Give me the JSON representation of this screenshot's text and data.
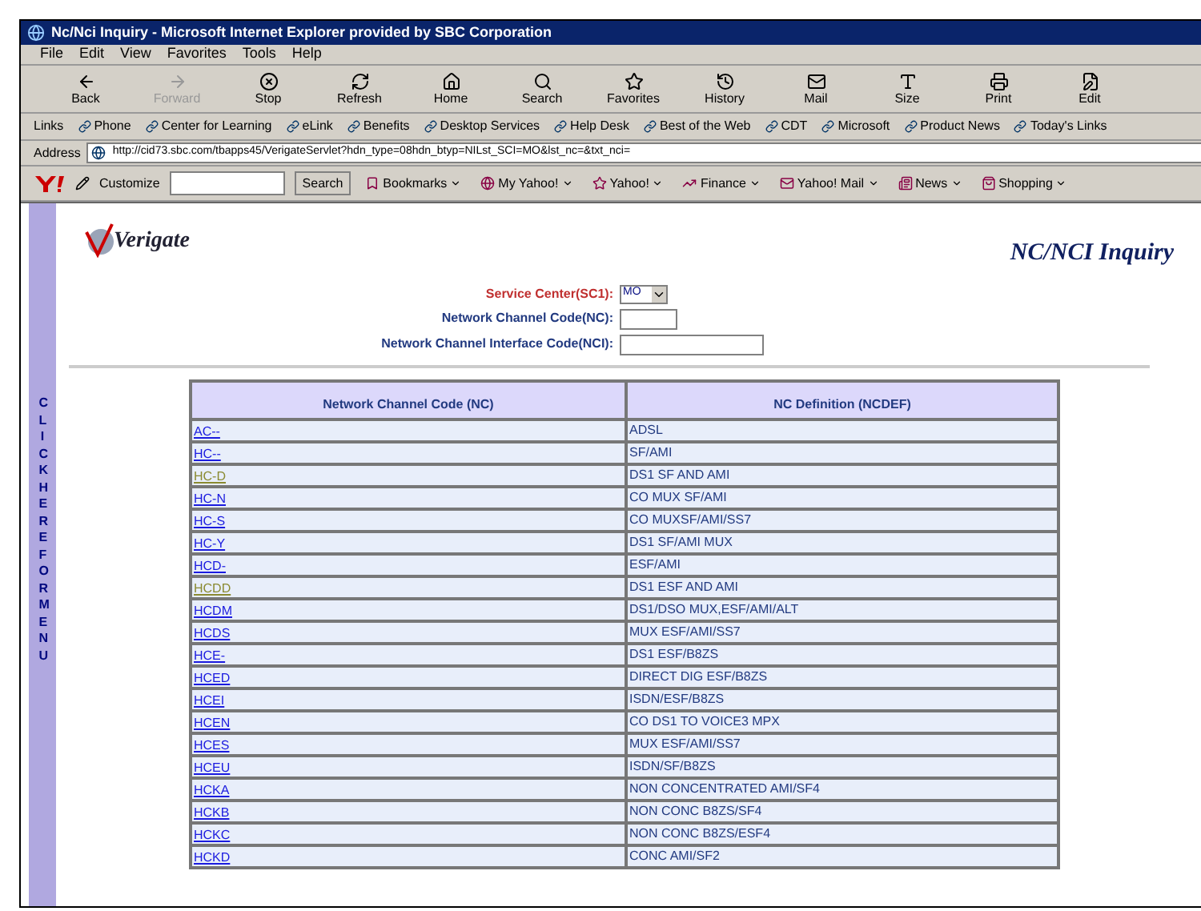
{
  "window": {
    "title": "Nc/Nci Inquiry - Microsoft Internet Explorer provided by SBC Corporation"
  },
  "menu": [
    "File",
    "Edit",
    "View",
    "Favorites",
    "Tools",
    "Help"
  ],
  "toolbar": [
    {
      "label": "Back",
      "disabled": false
    },
    {
      "label": "Forward",
      "disabled": true
    },
    {
      "label": "Stop",
      "disabled": false
    },
    {
      "label": "Refresh",
      "disabled": false
    },
    {
      "label": "Home",
      "disabled": false
    },
    {
      "label": "Search",
      "disabled": false
    },
    {
      "label": "Favorites",
      "disabled": false
    },
    {
      "label": "History",
      "disabled": false
    },
    {
      "label": "Mail",
      "disabled": false
    },
    {
      "label": "Size",
      "disabled": false
    },
    {
      "label": "Print",
      "disabled": false
    },
    {
      "label": "Edit",
      "disabled": false
    }
  ],
  "links_bar": {
    "label": "Links",
    "items": [
      "Phone",
      "Center for Learning",
      "eLink",
      "Benefits",
      "Desktop Services",
      "Help Desk",
      "Best of the Web",
      "CDT",
      "Microsoft",
      "Product News",
      "Today's Links"
    ]
  },
  "address_bar": {
    "label": "Address",
    "url": "http://cid73.sbc.com/tbapps45/VerigateServlet?hdn_type=08hdn_btyp=NILst_SCI=MO&lst_nc=&txt_nci="
  },
  "yahoo_bar": {
    "customize": "Customize",
    "search_button": "Search",
    "items": [
      "Bookmarks",
      "My Yahoo!",
      "Yahoo!",
      "Finance",
      "Yahoo! Mail",
      "News",
      "Shopping"
    ]
  },
  "side_menu": {
    "label": "CLICK HERE FOR MENU"
  },
  "page": {
    "logo": "erigate",
    "logo_initial": "V",
    "title": "NC/NCI Inquiry",
    "form": [
      {
        "label": "Service Center(SC1):",
        "kind": "select",
        "value": "MO",
        "required": true
      },
      {
        "label": "Network Channel Code(NC):",
        "kind": "text",
        "required": false
      },
      {
        "label": "Network Channel Interface Code(NCI):",
        "kind": "text",
        "required": false
      }
    ]
  },
  "table": {
    "columns": [
      "Network Channel Code (NC)",
      "NC Definition (NCDEF)"
    ],
    "rows": [
      {
        "code": "AC--",
        "definition": "ADSL",
        "visited": false
      },
      {
        "code": "HC--",
        "definition": "SF/AMI",
        "visited": false
      },
      {
        "code": "HC-D",
        "definition": "DS1 SF AND AMI",
        "visited": true
      },
      {
        "code": "HC-N",
        "definition": "CO MUX SF/AMI",
        "visited": false
      },
      {
        "code": "HC-S",
        "definition": "CO MUXSF/AMI/SS7",
        "visited": false
      },
      {
        "code": "HC-Y",
        "definition": "DS1 SF/AMI MUX",
        "visited": false
      },
      {
        "code": "HCD-",
        "definition": "ESF/AMI",
        "visited": false
      },
      {
        "code": "HCDD",
        "definition": "DS1 ESF AND AMI",
        "visited": true
      },
      {
        "code": "HCDM",
        "definition": "DS1/DSO MUX,ESF/AMI/ALT",
        "visited": false
      },
      {
        "code": "HCDS",
        "definition": "MUX ESF/AMI/SS7",
        "visited": false
      },
      {
        "code": "HCE-",
        "definition": "DS1 ESF/B8ZS",
        "visited": false
      },
      {
        "code": "HCED",
        "definition": "DIRECT DIG ESF/B8ZS",
        "visited": false
      },
      {
        "code": "HCEI",
        "definition": "ISDN/ESF/B8ZS",
        "visited": false
      },
      {
        "code": "HCEN",
        "definition": "CO DS1 TO VOICE3 MPX",
        "visited": false
      },
      {
        "code": "HCES",
        "definition": "MUX ESF/AMI/SS7",
        "visited": false
      },
      {
        "code": "HCEU",
        "definition": "ISDN/SF/B8ZS",
        "visited": false
      },
      {
        "code": "HCKA",
        "definition": "NON CONCENTRATED AMI/SF4",
        "visited": false
      },
      {
        "code": "HCKB",
        "definition": "NON CONC B8ZS/SF4",
        "visited": false
      },
      {
        "code": "HCKC",
        "definition": "NON CONC B8ZS/ESF4",
        "visited": false
      },
      {
        "code": "HCKD",
        "definition": "CONC AMI/SF2",
        "visited": false
      }
    ]
  }
}
